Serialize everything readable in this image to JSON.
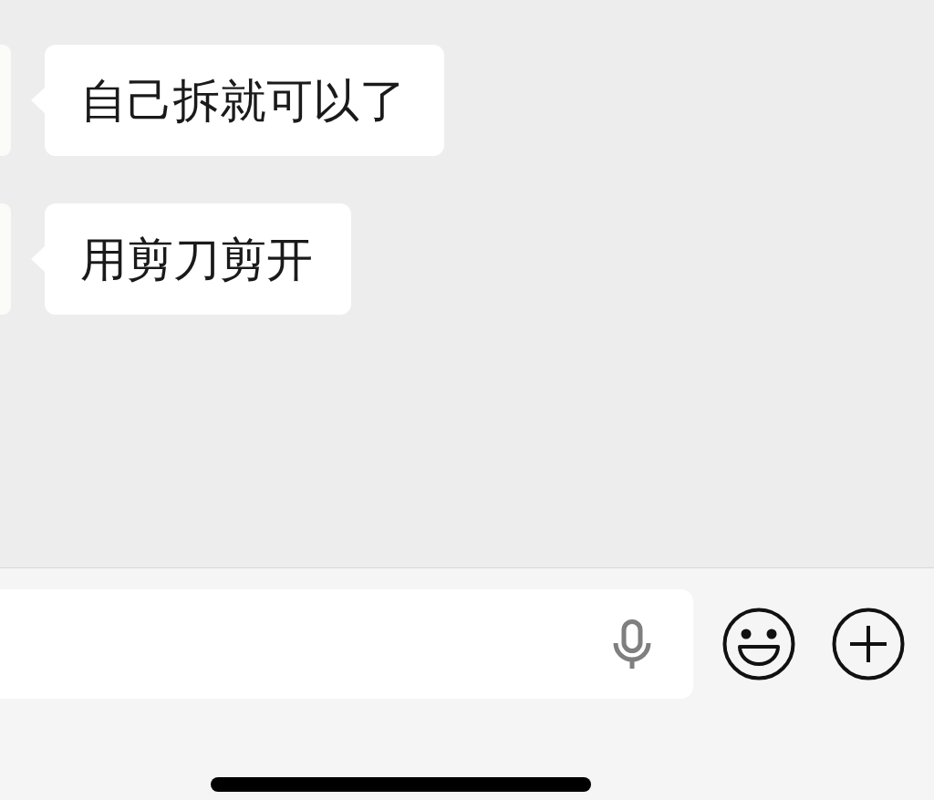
{
  "messages": [
    {
      "kind": "received",
      "text": "自己拆就可以了"
    },
    {
      "kind": "received",
      "text": "用剪刀剪开"
    }
  ]
}
